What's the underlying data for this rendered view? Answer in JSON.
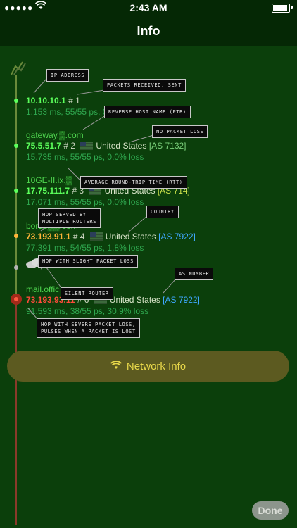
{
  "status_bar": {
    "signal": "●●●●●",
    "time": "2:43 AM"
  },
  "nav": {
    "title": "Info"
  },
  "hops": [
    {
      "host": "",
      "ip": "10.10.10.1",
      "hop": "# 1",
      "country": "",
      "as": "",
      "stats": "1.153 ms, 55/55 ps, 0.0% loss"
    },
    {
      "host": "gateway.",
      "host_suffix": ".com",
      "ip": "75.5.51.7",
      "hop": "# 2",
      "country": "United States",
      "as": "[AS 7132]",
      "stats": "15.735 ms, 55/55 ps, 0.0% loss"
    },
    {
      "host": "10GE-II.ix.",
      "ip": "17.75.111.7",
      "hop": "# 3",
      "country": "United States",
      "as": "[AS 714]",
      "stats": "17.071 ms, 55/55 ps, 0.0% loss"
    },
    {
      "host": "borde",
      "host_suffix": ".com",
      "ip": "73.193.91.1",
      "hop": "# 4",
      "country": "United States",
      "as": "[AS 7922]",
      "stats": "77.391 ms, 54/55 ps, 1.8% loss"
    },
    {
      "host": "mail.offic",
      "ip": "73.193.93.11",
      "hop": "# 6",
      "country": "United States",
      "as": "[AS 7922]",
      "stats": "91.593 ms, 38/55 ps, 30.9% loss"
    }
  ],
  "callouts": {
    "ip_address": "IP ADDRESS",
    "packets": "PACKETS RECEIVED, SENT",
    "reverse": "REVERSE HOST NAME (PTR)",
    "no_loss": "NO PACKET LOSS",
    "rtt": "AVERAGE ROUND-TRIP TIME (RTT)",
    "country": "COUNTRY",
    "multi_1": "HOP SERVED BY",
    "multi_2": "MULTIPLE ROUTERS",
    "slight": "HOP WITH SLIGHT PACKET LOSS",
    "as_number": "AS NUMBER",
    "silent": "SILENT ROUTER",
    "severe_1": "HOP WITH SEVERE PACKET LOSS,",
    "severe_2": "PULSES WHEN A PACKET IS LOST"
  },
  "network_button": {
    "label": "Network Info",
    "icon": "wifi-icon"
  },
  "done_button": {
    "label": "Done"
  },
  "colors": {
    "background": "#0b3f0b",
    "ok": "#5cff5c",
    "warn": "#ffb43a",
    "bad": "#ff4b3b",
    "as_blue": "#3fa8ff"
  }
}
